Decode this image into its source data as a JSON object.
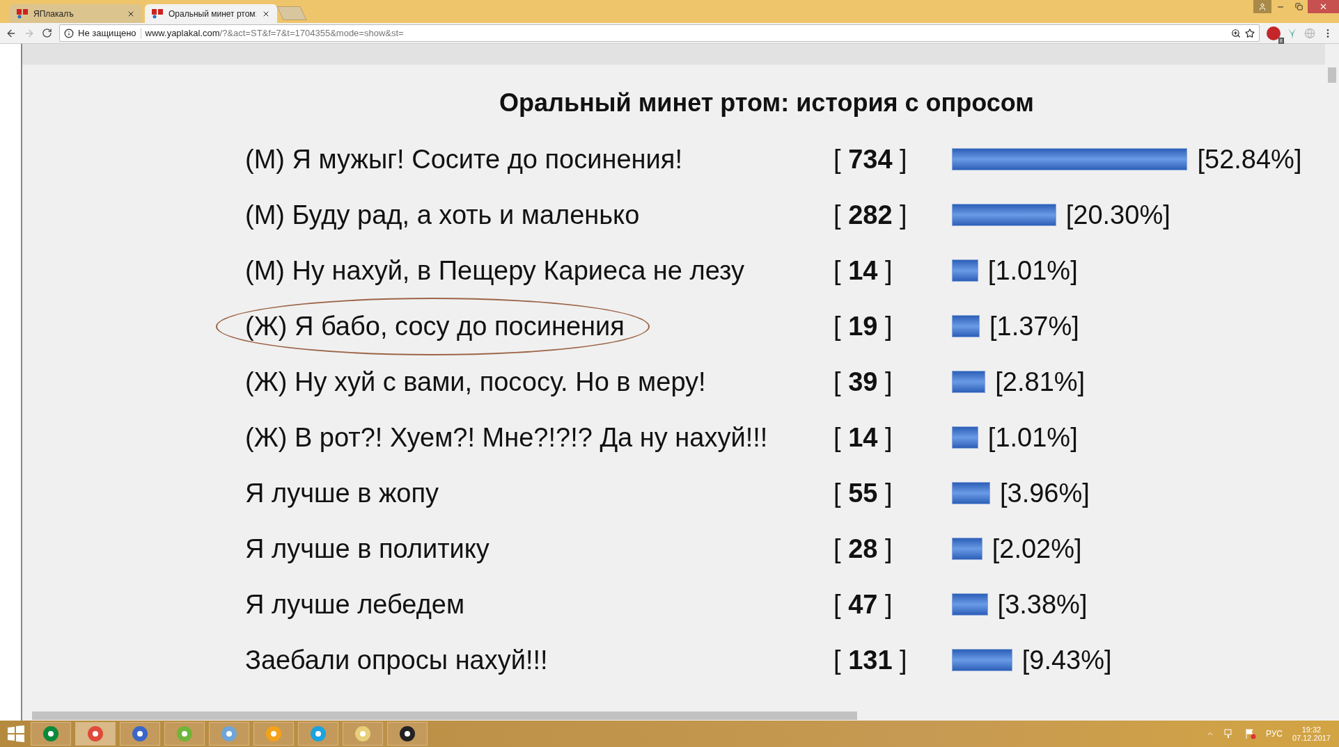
{
  "tabs": [
    {
      "label": "ЯПлакалъ",
      "selected": false
    },
    {
      "label": "Оральный минет ртом:",
      "selected": true
    }
  ],
  "address": {
    "security": "Не защищено",
    "url_host": "www.yaplakal.com",
    "url_path": "/?&act=ST&f=7&t=1704355&mode=show&st="
  },
  "extension_badge": "8",
  "poll": {
    "title": "Оральный минет ртом: история с опросом",
    "options": [
      {
        "label": "(М) Я мужыг! Сосите до посинения!",
        "votes": "[ **734** ]",
        "percent": "[52.84%]",
        "circled": false
      },
      {
        "label": "(М) Буду рад, а хоть и маленько",
        "votes": "[ **282** ]",
        "percent": "[20.30%]",
        "circled": false
      },
      {
        "label": "(М) Ну нахуй, в Пещеру Кариеса не лезу",
        "votes": "[ **14** ]",
        "percent": "[1.01%]",
        "circled": false
      },
      {
        "label": "(Ж) Я бабо, сосу до посинения",
        "votes": "[ **19** ]",
        "percent": "[1.37%]",
        "circled": true
      },
      {
        "label": "(Ж) Ну хуй с вами, пососу. Но в меру!",
        "votes": "[ **39** ]",
        "percent": "[2.81%]",
        "circled": false
      },
      {
        "label": "(Ж) В рот?! Хуем?! Мне?!?!? Да ну нахуй!!!",
        "votes": "[ **14** ]",
        "percent": "[1.01%]",
        "circled": false
      },
      {
        "label": "Я лучше в жопу",
        "votes": "[ **55** ]",
        "percent": "[3.96%]",
        "circled": false
      },
      {
        "label": "Я лучше в политику",
        "votes": "[ **28** ]",
        "percent": "[2.02%]",
        "circled": false
      },
      {
        "label": "Я лучше лебедем",
        "votes": "[ **47** ]",
        "percent": "[3.38%]",
        "circled": false
      },
      {
        "label": "Заебали опросы нахуй!!!",
        "votes": "[ **131** ]",
        "percent": "[9.43%]",
        "circled": false
      }
    ]
  },
  "taskbar": {
    "language": "РУС",
    "time": "19:32",
    "date": "07.12.2017"
  }
}
